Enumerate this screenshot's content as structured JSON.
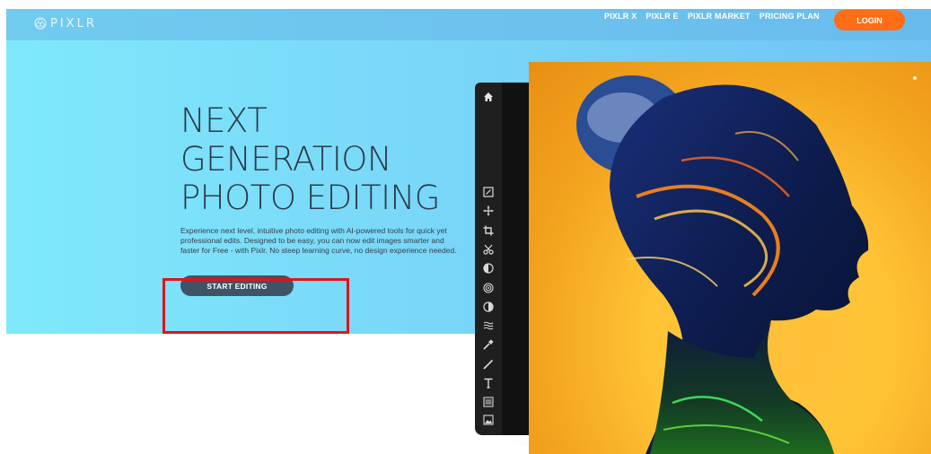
{
  "brand": {
    "logo_text": "PIXLR"
  },
  "nav": {
    "items": [
      "PIXLR X",
      "PIXLR E",
      "PIXLR MARKET",
      "PRICING PLAN"
    ],
    "login": "LOGIN"
  },
  "hero": {
    "headline": [
      "NEXT",
      "GENERATION",
      "PHOTO EDITING"
    ],
    "description": "Experience next level, intuitive photo editing with AI-powered tools for quick yet professional edits. Designed to be easy, you can now edit images smarter and faster for Free - with Pixlr. No steep learning curve, no design experience needed.",
    "cta": "START EDITING"
  },
  "editor": {
    "tools": [
      "home-icon",
      "resize-icon",
      "move-icon",
      "crop-icon",
      "cutout-icon",
      "liquify-icon",
      "focus-icon",
      "adjust-icon",
      "filter-icon",
      "brush-tool-icon",
      "draw-icon",
      "text-icon",
      "element-icon",
      "image-icon"
    ]
  },
  "colors": {
    "accent": "#ff6e16",
    "cta": "#3e5466",
    "highlight": "#e5111b",
    "hero_start": "#7fe9fb",
    "hero_end": "#6fc3f4"
  }
}
